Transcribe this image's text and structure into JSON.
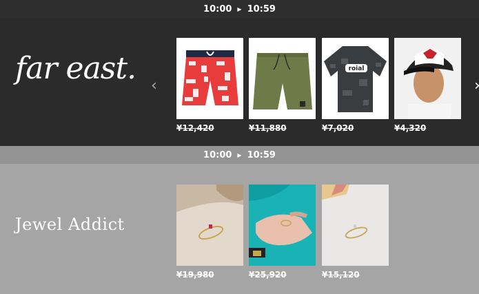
{
  "sections": [
    {
      "time_start": "10:00",
      "time_end": "10:59",
      "brand": "far east.",
      "products": [
        {
          "icon": "board-shorts-image",
          "price": "¥12,420"
        },
        {
          "icon": "olive-shorts-image",
          "price": "¥11,880"
        },
        {
          "icon": "rash-guard-image",
          "price": "¥7,020"
        },
        {
          "icon": "cap-model-image",
          "price": "¥4,320"
        }
      ]
    },
    {
      "time_start": "10:00",
      "time_end": "10:59",
      "brand": "Jewel Addict",
      "products": [
        {
          "icon": "ring-on-stone-image",
          "price": "¥19,980"
        },
        {
          "icon": "ring-on-hand-image",
          "price": "¥25,920"
        },
        {
          "icon": "ring-on-table-image",
          "price": "¥15,120"
        }
      ]
    }
  ],
  "colors": {
    "dark_bg": "#2b2b2b",
    "header_dark": "#2e2e2e",
    "light_bg": "#a5a5a5",
    "header_light": "#939393"
  }
}
